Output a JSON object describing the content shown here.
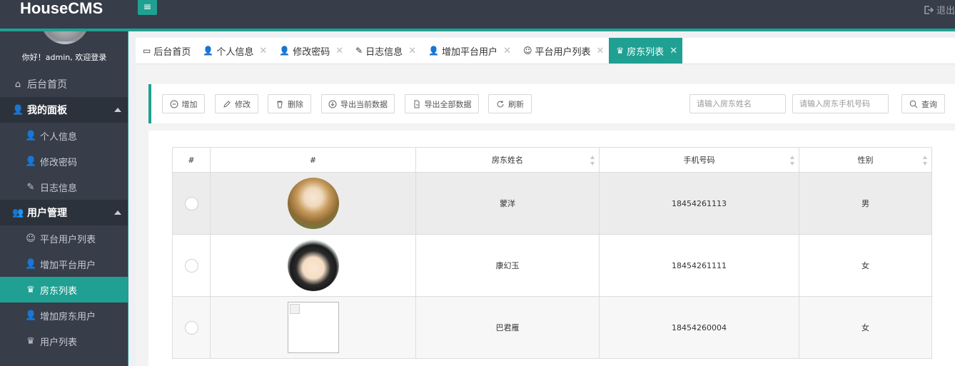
{
  "app": {
    "brand": "HouseCMS",
    "logout_label": "退出",
    "menu_toggle_glyph": "≡"
  },
  "colors": {
    "accent": "#1fa092",
    "topbar": "#373d49",
    "sidebar": "#373d49"
  },
  "sidebar": {
    "welcome": "你好！admin, 欢迎登录",
    "items": [
      {
        "label": "后台首页",
        "icon": "home-icon",
        "glyph": "⌂",
        "kind": "top"
      },
      {
        "label": "我的面板",
        "icon": "user-icon",
        "glyph": "👤",
        "kind": "group"
      },
      {
        "label": "个人信息",
        "icon": "user-card-icon",
        "glyph": "👤",
        "kind": "sub"
      },
      {
        "label": "修改密码",
        "icon": "user-lock-icon",
        "glyph": "👤",
        "kind": "sub"
      },
      {
        "label": "日志信息",
        "icon": "edit-icon",
        "glyph": "✎",
        "kind": "sub"
      },
      {
        "label": "用户管理",
        "icon": "users-icon",
        "glyph": "👥",
        "kind": "group"
      },
      {
        "label": "平台用户列表",
        "icon": "users-outline-icon",
        "glyph": "☺",
        "kind": "sub"
      },
      {
        "label": "增加平台用户",
        "icon": "user-add-icon",
        "glyph": "👤",
        "kind": "sub"
      },
      {
        "label": "房东列表",
        "icon": "crown-icon",
        "glyph": "♛",
        "kind": "sub",
        "active": true
      },
      {
        "label": "增加房东用户",
        "icon": "user-add-icon",
        "glyph": "👤",
        "kind": "sub"
      },
      {
        "label": "用户列表",
        "icon": "crown-icon",
        "glyph": "♛",
        "kind": "sub"
      }
    ]
  },
  "tabs": [
    {
      "label": "后台首页",
      "icon": "monitor-icon",
      "glyph": "▭",
      "closable": false
    },
    {
      "label": "个人信息",
      "icon": "user-card-icon",
      "glyph": "👤",
      "closable": true
    },
    {
      "label": "修改密码",
      "icon": "user-lock-icon",
      "glyph": "👤",
      "closable": true
    },
    {
      "label": "日志信息",
      "icon": "edit-icon",
      "glyph": "✎",
      "closable": true
    },
    {
      "label": "增加平台用户",
      "icon": "user-add-icon",
      "glyph": "👤",
      "closable": true
    },
    {
      "label": "平台用户列表",
      "icon": "users-outline-icon",
      "glyph": "☺",
      "closable": true
    },
    {
      "label": "房东列表",
      "icon": "crown-icon",
      "glyph": "♛",
      "closable": true,
      "active": true
    }
  ],
  "tab_close_glyph": "✕",
  "toolbar": {
    "add": "增加",
    "edit": "修改",
    "delete": "删除",
    "export_current": "导出当前数据",
    "export_all": "导出全部数据",
    "refresh": "刷新",
    "name_placeholder": "请输入房东姓名",
    "phone_placeholder": "请输入房东手机号码",
    "search": "查询"
  },
  "table": {
    "headers": [
      "#",
      "#",
      "房东姓名",
      "手机号码",
      "性别"
    ],
    "rows": [
      {
        "avatar": "anime-girl",
        "name": "蒙洋",
        "phone": "18454261113",
        "gender": "男"
      },
      {
        "avatar": "cartoon-boy",
        "name": "康幻玉",
        "phone": "18454261111",
        "gender": "女"
      },
      {
        "avatar": "broken",
        "name": "巴君雁",
        "phone": "18454260004",
        "gender": "女"
      }
    ]
  }
}
